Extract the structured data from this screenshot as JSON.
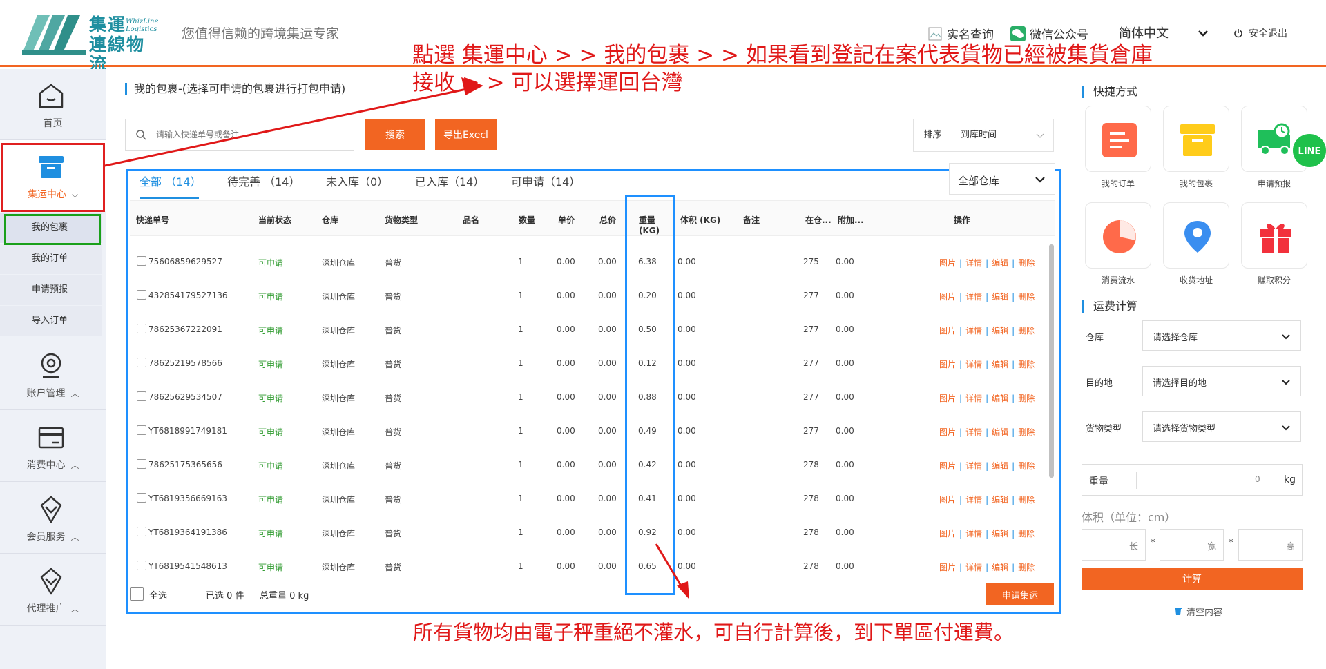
{
  "header": {
    "logo_line1": "集運",
    "logo_line2": "連線物流",
    "logo_en": "WhizLine Logistics",
    "slogan": "您值得信赖的跨境集运专家",
    "realname_label": "实名查询",
    "wechat_label": "微信公众号",
    "language": "简体中文",
    "logout_label": "安全退出"
  },
  "sidebar": {
    "items": [
      {
        "label": "首页"
      },
      {
        "label": "集运中心"
      },
      {
        "label": "账户管理"
      },
      {
        "label": "消费中心"
      },
      {
        "label": "会员服务"
      },
      {
        "label": "代理推广"
      }
    ],
    "subitems": [
      "我的包裹",
      "我的订单",
      "申请预报",
      "导入订单"
    ]
  },
  "main": {
    "title": "我的包裹-(选择可申请的包裹进行打包申请)",
    "search_placeholder": "请输入快递单号或备注",
    "search_button": "搜索",
    "export_button": "导出Execl",
    "sort_label": "排序",
    "sort_value": "到库时间",
    "tabs": [
      {
        "label": "全部 （14）"
      },
      {
        "label": "待完善 （14）"
      },
      {
        "label": "未入库（0）"
      },
      {
        "label": "已入库（14）"
      },
      {
        "label": "可申请（14）"
      }
    ],
    "warehouse_filter": "全部仓库",
    "columns": [
      "快递单号",
      "当前状态",
      "仓库",
      "货物类型",
      "品名",
      "数量",
      "单价",
      "总价",
      "重量 (KG)",
      "体积 (KG)",
      "备注",
      "在仓...",
      "附加...",
      "操作"
    ],
    "rows": [
      {
        "no": "75606859629527",
        "status": "可申请",
        "wh": "深圳仓库",
        "type": "普货",
        "qty": "1",
        "price": "0.00",
        "total": "0.00",
        "weight": "6.38",
        "vol": "0.00",
        "days": "275",
        "extra": "0.00"
      },
      {
        "no": "432854179527136",
        "status": "可申请",
        "wh": "深圳仓库",
        "type": "普货",
        "qty": "1",
        "price": "0.00",
        "total": "0.00",
        "weight": "0.20",
        "vol": "0.00",
        "days": "277",
        "extra": "0.00"
      },
      {
        "no": "78625367222091",
        "status": "可申请",
        "wh": "深圳仓库",
        "type": "普货",
        "qty": "1",
        "price": "0.00",
        "total": "0.00",
        "weight": "0.50",
        "vol": "0.00",
        "days": "277",
        "extra": "0.00"
      },
      {
        "no": "78625219578566",
        "status": "可申请",
        "wh": "深圳仓库",
        "type": "普货",
        "qty": "1",
        "price": "0.00",
        "total": "0.00",
        "weight": "0.12",
        "vol": "0.00",
        "days": "277",
        "extra": "0.00"
      },
      {
        "no": "78625629534507",
        "status": "可申请",
        "wh": "深圳仓库",
        "type": "普货",
        "qty": "1",
        "price": "0.00",
        "total": "0.00",
        "weight": "0.88",
        "vol": "0.00",
        "days": "277",
        "extra": "0.00"
      },
      {
        "no": "YT6818991749181",
        "status": "可申请",
        "wh": "深圳仓库",
        "type": "普货",
        "qty": "1",
        "price": "0.00",
        "total": "0.00",
        "weight": "0.49",
        "vol": "0.00",
        "days": "277",
        "extra": "0.00"
      },
      {
        "no": "78625175365656",
        "status": "可申请",
        "wh": "深圳仓库",
        "type": "普货",
        "qty": "1",
        "price": "0.00",
        "total": "0.00",
        "weight": "0.42",
        "vol": "0.00",
        "days": "278",
        "extra": "0.00"
      },
      {
        "no": "YT6819356669163",
        "status": "可申请",
        "wh": "深圳仓库",
        "type": "普货",
        "qty": "1",
        "price": "0.00",
        "total": "0.00",
        "weight": "0.41",
        "vol": "0.00",
        "days": "278",
        "extra": "0.00"
      },
      {
        "no": "YT6819364191386",
        "status": "可申请",
        "wh": "深圳仓库",
        "type": "普货",
        "qty": "1",
        "price": "0.00",
        "total": "0.00",
        "weight": "0.92",
        "vol": "0.00",
        "days": "278",
        "extra": "0.00"
      },
      {
        "no": "YT6819541548613",
        "status": "可申请",
        "wh": "深圳仓库",
        "type": "普货",
        "qty": "1",
        "price": "0.00",
        "total": "0.00",
        "weight": "0.65",
        "vol": "0.00",
        "days": "278",
        "extra": "0.00"
      }
    ],
    "ops": {
      "img": "图片",
      "detail": "详情",
      "edit": "编辑",
      "del": "删除",
      "sep": "|"
    },
    "footer": {
      "select_all": "全选",
      "selected": "已选 0 件",
      "total_weight": "总重量 0 kg",
      "apply_button": "申请集运"
    }
  },
  "annotations": {
    "top_line1": "點選  集運中心 > > 我的包裹 > > 如果看到登記在案代表貨物已經被集貨倉庫",
    "top_line2": "接收 > > 可以選擇運回台灣",
    "bottom": "所有貨物均由電子秤重絕不灌水，可自行計算後，到下單區付運費。",
    "color": "#e01818"
  },
  "right_panel": {
    "quick_title": "快捷方式",
    "quick": [
      "我的订单",
      "我的包裹",
      "申请预报",
      "消费流水",
      "收货地址",
      "赚取积分"
    ],
    "calc_title": "运费计算",
    "warehouse_label": "仓库",
    "warehouse_ph": "请选择仓库",
    "dest_label": "目的地",
    "dest_ph": "请选择目的地",
    "cargo_label": "货物类型",
    "cargo_ph": "请选择货物类型",
    "weight_label": "重量",
    "weight_value": "0",
    "weight_unit": "kg",
    "volume_label": "体积（单位：cm）",
    "len": "长",
    "wid": "宽",
    "hei": "高",
    "star": "*",
    "calc_button": "计算",
    "clear_label": "清空内容",
    "line_badge": "LINE"
  },
  "colors": {
    "accent": "#f26522",
    "primary": "#1f8fe0",
    "status_green": "#2e9a2e"
  }
}
